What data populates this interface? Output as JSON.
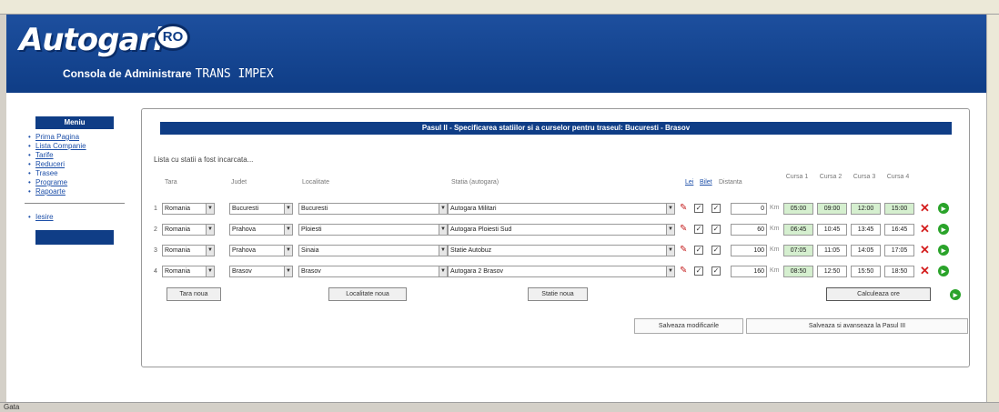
{
  "header": {
    "logo_main": "Autogari",
    "logo_badge": "RO",
    "subtitle": "Consola de Administrare",
    "company": "TRANS IMPEX"
  },
  "sidebar": {
    "title": "Meniu",
    "items": [
      {
        "label": "Prima Pagina",
        "link": true
      },
      {
        "label": "Lista Companie",
        "link": true
      },
      {
        "label": "Tarife",
        "link": true
      },
      {
        "label": "Reduceri",
        "link": true
      },
      {
        "label": "Trasee",
        "link": false
      },
      {
        "label": "Programe",
        "link": true
      },
      {
        "label": "Rapoarte",
        "link": true
      }
    ],
    "logout": "Iesire"
  },
  "main": {
    "step_title": "Pasul II - Specificarea statiilor si a curselor pentru traseul: Bucuresti - Brasov",
    "station_count": "Lista cu statii a fost incarcata..."
  },
  "columns": {
    "country": "Tara",
    "county": "Judet",
    "locality": "Localitate",
    "station": "Statia (autogara)",
    "lei": "Lei",
    "bilet": "Bilet",
    "distance": "Distanta",
    "courses": [
      "Cursa 1",
      "Cursa 2",
      "Cursa 3",
      "Cursa 4"
    ]
  },
  "rows": [
    {
      "index": "1",
      "country": "Romania",
      "county": "Bucuresti",
      "locality": "Bucuresti",
      "station": "Autogara Militari",
      "km": "0",
      "times": [
        "05:00",
        "09:00",
        "12:00",
        "15:00"
      ]
    },
    {
      "index": "2",
      "country": "Romania",
      "county": "Prahova",
      "locality": "Ploiesti",
      "station": "Autogara Ploiesti Sud",
      "km": "60",
      "times": [
        "06:45",
        "10:45",
        "13:45",
        "16:45"
      ]
    },
    {
      "index": "3",
      "country": "Romania",
      "county": "Prahova",
      "locality": "Sinaia",
      "station": "Statie Autobuz",
      "km": "100",
      "times": [
        "07:05",
        "11:05",
        "14:05",
        "17:05"
      ]
    },
    {
      "index": "4",
      "country": "Romania",
      "county": "Brasov",
      "locality": "Brasov",
      "station": "Autogara 2 Brasov",
      "km": "160",
      "times": [
        "08:50",
        "12:50",
        "15:50",
        "18:50"
      ]
    }
  ],
  "unit_km": "Km",
  "buttons": {
    "new_country": "Tara noua",
    "new_locality": "Localitate noua",
    "new_station": "Statie noua",
    "calculate_times": "Calculeaza ore",
    "save_changes": "Salveaza modificarile",
    "save_continue": "Salveaza si avanseaza la Pasul III"
  },
  "status_bar": "Gata",
  "colors": {
    "header_blue": "#0f3d86",
    "green_time": "#d5efcf",
    "delete_red": "#d41e1e"
  }
}
